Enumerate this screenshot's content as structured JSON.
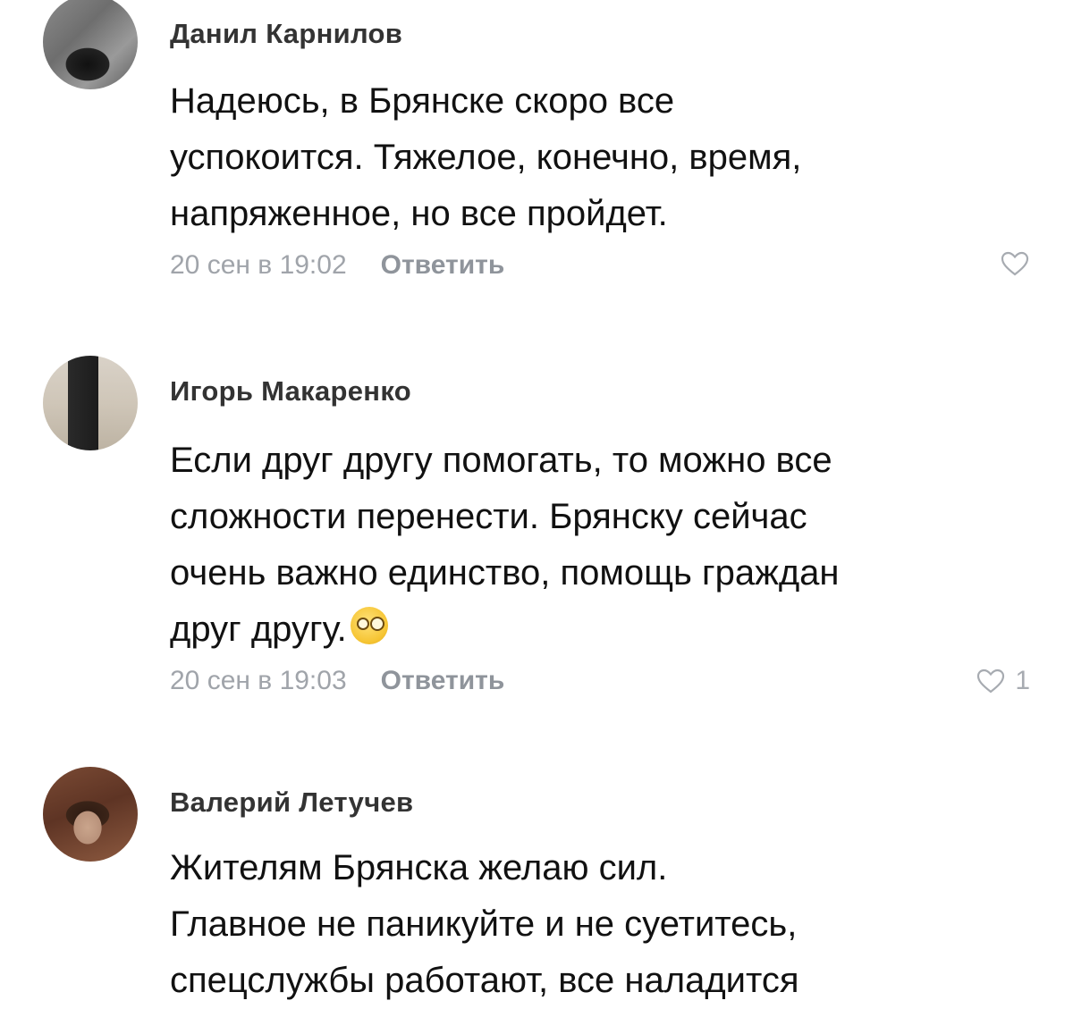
{
  "comments": [
    {
      "author": "Данил Карнилов",
      "text_lines": [
        "Надеюсь, в Брянске скоро все",
        "успокоится. Тяжелое, конечно, время,",
        "напряженное, но все пройдет."
      ],
      "date": "20 сен в 19:02",
      "reply_label": "Ответить",
      "likes": ""
    },
    {
      "author": "Игорь Макаренко",
      "text_lines": [
        "Если друг другу помогать, то можно все",
        "сложности перенести. Брянску сейчас",
        "очень важно единство, помощь граждан",
        "друг другу."
      ],
      "emoji": "thinking-face-icon",
      "date": "20 сен в 19:03",
      "reply_label": "Ответить",
      "likes": "1"
    },
    {
      "author": "Валерий Летучев",
      "text_lines": [
        "Жителям Брянска желаю сил.",
        "Главное не паникуйте и не суетитесь,",
        "спецслужбы работают, все наладится"
      ],
      "date": "",
      "reply_label": "",
      "likes": ""
    }
  ],
  "colors": {
    "author": "#333333",
    "text": "#111111",
    "meta": "#9a9ea5",
    "heart": "#a7abb1"
  }
}
